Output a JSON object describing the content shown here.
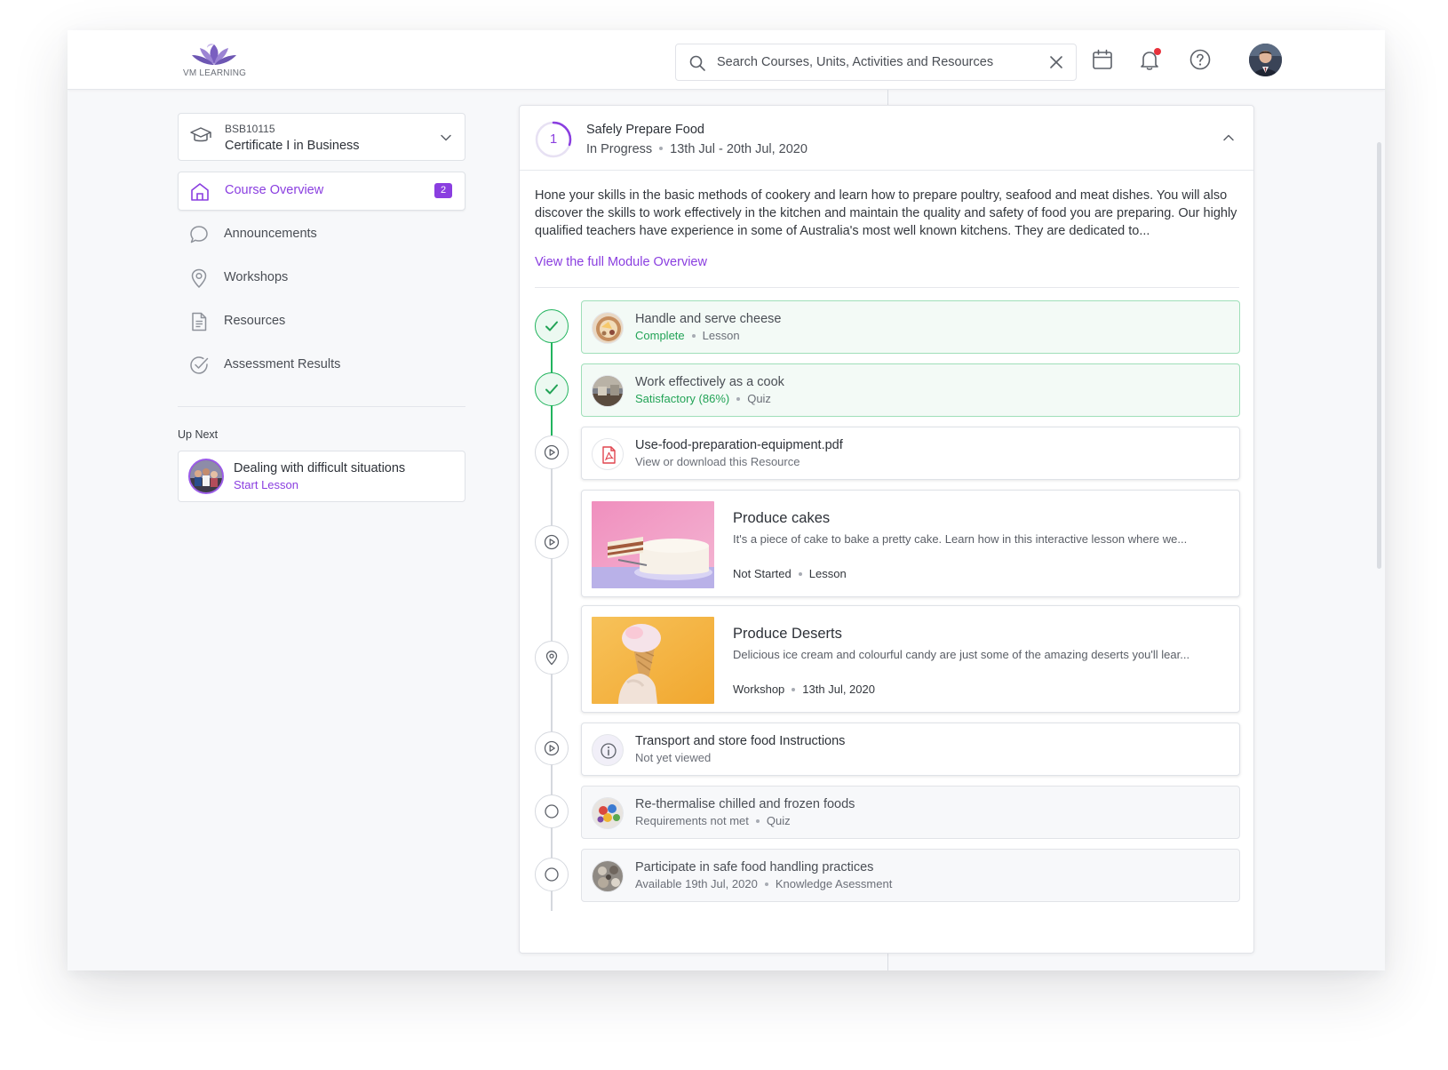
{
  "header": {
    "brand": "VM LEARNING",
    "search": {
      "placeholder": "Search Courses, Units, Activities and Resources",
      "value": ""
    },
    "icons": [
      "calendar-icon",
      "bell-icon",
      "help-icon",
      "user-avatar"
    ],
    "notification_dot_color": "#e8323c"
  },
  "sidebar": {
    "course": {
      "code": "BSB10115",
      "name": "Certificate I in Business"
    },
    "items": [
      {
        "label": "Course Overview",
        "icon": "home-icon",
        "badge": "2",
        "active": true
      },
      {
        "label": "Announcements",
        "icon": "chat-bubble-icon"
      },
      {
        "label": "Workshops",
        "icon": "location-pin-icon"
      },
      {
        "label": "Resources",
        "icon": "document-icon"
      },
      {
        "label": "Assessment Results",
        "icon": "check-circle-icon"
      }
    ],
    "up_next": {
      "title": "Up Next",
      "name": "Dealing with difficult situations",
      "cta": "Start Lesson"
    }
  },
  "module": {
    "number": "1",
    "title": "Safely Prepare Food",
    "status": "In Progress",
    "dates": "13th Jul - 20th Jul, 2020",
    "progress": 0.3,
    "description": "Hone your skills in the basic methods of cookery and learn how to prepare poultry, seafood and meat dishes. You will also discover the skills to work effectively in the kitchen and maintain the quality and safety of food you are preparing. Our highly qualified teachers have experience in some of Australia's most well known kitchens. They are dedicated to...",
    "link": "View the full Module Overview",
    "activities": [
      {
        "title": "Handle and serve cheese",
        "status": "Complete",
        "type": "Lesson"
      },
      {
        "title": "Work effectively as a cook",
        "status": "Satisfactory (86%)",
        "type": "Quiz"
      },
      {
        "title": "Use-food-preparation-equipment.pdf",
        "status": "View or download this Resource"
      },
      {
        "title": "Produce cakes",
        "description": "It's a piece of cake to bake a pretty cake. Learn how in this interactive lesson where we...",
        "status": "Not Started",
        "type": "Lesson"
      },
      {
        "title": "Produce Deserts",
        "description": "Delicious ice cream and colourful candy are just some of the amazing deserts you'll lear...",
        "status": "Workshop",
        "type": "13th Jul, 2020"
      },
      {
        "title": "Transport and store food Instructions",
        "status": "Not yet viewed"
      },
      {
        "title": "Re-thermalise chilled and frozen foods",
        "status": "Requirements not met",
        "type": "Quiz"
      },
      {
        "title": "Participate in safe food handling practices",
        "status": "Available 19th Jul, 2020",
        "type": "Knowledge Asessment"
      }
    ]
  },
  "colors": {
    "accent": "#8a3ee0",
    "success": "#22b45e",
    "danger": "#e8323c"
  }
}
